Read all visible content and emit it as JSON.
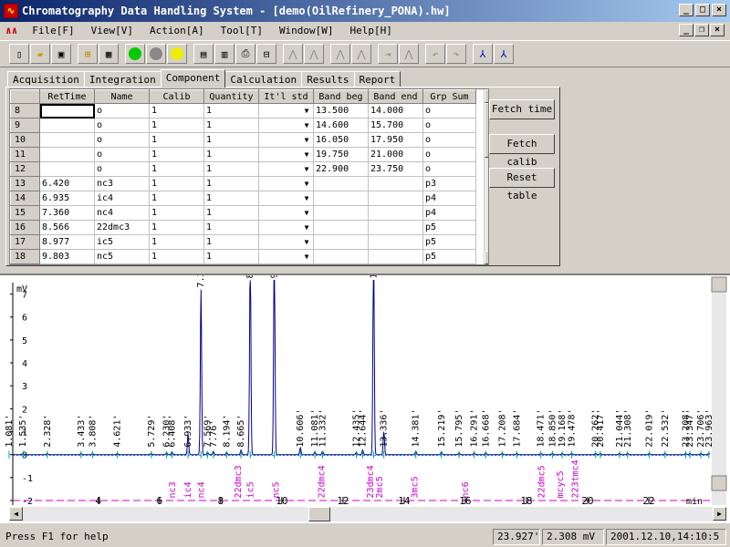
{
  "window": {
    "title": "Chromatography Data Handling System - [demo(OilRefinery_PONA).hw]"
  },
  "menu": [
    "File[F]",
    "View[V]",
    "Action[A]",
    "Tool[T]",
    "Window[W]",
    "Help[H]"
  ],
  "tabs": [
    "Acquisition",
    "Integration",
    "Component",
    "Calculation",
    "Results",
    "Report"
  ],
  "table": {
    "columns": [
      "RetTime",
      "Name",
      "Calib",
      "Quantity",
      "It'l std",
      "Band beg",
      "Band end",
      "Grp Sum"
    ],
    "rows": [
      {
        "n": "8",
        "ret": "",
        "name": "o",
        "calib": "1",
        "qty": "1",
        "std": "",
        "beg": "13.500",
        "end": "14.000",
        "grp": "o"
      },
      {
        "n": "9",
        "ret": "",
        "name": "o",
        "calib": "1",
        "qty": "1",
        "std": "",
        "beg": "14.600",
        "end": "15.700",
        "grp": "o"
      },
      {
        "n": "10",
        "ret": "",
        "name": "o",
        "calib": "1",
        "qty": "1",
        "std": "",
        "beg": "16.050",
        "end": "17.950",
        "grp": "o"
      },
      {
        "n": "11",
        "ret": "",
        "name": "o",
        "calib": "1",
        "qty": "1",
        "std": "",
        "beg": "19.750",
        "end": "21.000",
        "grp": "o"
      },
      {
        "n": "12",
        "ret": "",
        "name": "o",
        "calib": "1",
        "qty": "1",
        "std": "",
        "beg": "22.900",
        "end": "23.750",
        "grp": "o"
      },
      {
        "n": "13",
        "ret": "6.420",
        "name": "nc3",
        "calib": "1",
        "qty": "1",
        "std": "",
        "beg": "",
        "end": "",
        "grp": "p3"
      },
      {
        "n": "14",
        "ret": "6.935",
        "name": "ic4",
        "calib": "1",
        "qty": "1",
        "std": "",
        "beg": "",
        "end": "",
        "grp": "p4"
      },
      {
        "n": "15",
        "ret": "7.360",
        "name": "nc4",
        "calib": "1",
        "qty": "1",
        "std": "",
        "beg": "",
        "end": "",
        "grp": "p4"
      },
      {
        "n": "16",
        "ret": "8.566",
        "name": "22dmc3",
        "calib": "1",
        "qty": "1",
        "std": "",
        "beg": "",
        "end": "",
        "grp": "p5"
      },
      {
        "n": "17",
        "ret": "8.977",
        "name": "ic5",
        "calib": "1",
        "qty": "1",
        "std": "",
        "beg": "",
        "end": "",
        "grp": "p5"
      },
      {
        "n": "18",
        "ret": "9.803",
        "name": "nc5",
        "calib": "1",
        "qty": "1",
        "std": "",
        "beg": "",
        "end": "",
        "grp": "p5"
      }
    ]
  },
  "buttons": {
    "fetch_time": "Fetch time",
    "fetch_calib": "Fetch calib",
    "reset_table": "Reset table"
  },
  "chart_data": {
    "type": "line",
    "ylabel": "mV",
    "xlabel": "min",
    "xlim": [
      1.2,
      24.0
    ],
    "ylim": [
      -2.2,
      7.5
    ],
    "yticks": [
      -2,
      -1,
      0,
      1,
      2,
      3,
      4,
      5,
      6,
      7
    ],
    "xticks": [
      4,
      6,
      8,
      10,
      12,
      14,
      16,
      18,
      20,
      22
    ],
    "peaks": [
      {
        "t": 1.081,
        "h": 0.05
      },
      {
        "t": 1.535,
        "h": 0.05
      },
      {
        "t": 2.328,
        "h": 0.05
      },
      {
        "t": 3.433,
        "h": 0.05
      },
      {
        "t": 3.808,
        "h": 0.05
      },
      {
        "t": 4.621,
        "h": 0.05
      },
      {
        "t": 5.729,
        "h": 0.05
      },
      {
        "t": 6.23,
        "h": 0.08
      },
      {
        "t": 6.408,
        "h": 0.12
      },
      {
        "t": 6.933,
        "h": 0.9
      },
      {
        "t": 7.355,
        "h": 7.2
      },
      {
        "t": 7.569,
        "h": 0.1
      },
      {
        "t": 7.76,
        "h": 0.15
      },
      {
        "t": 8.194,
        "h": 0.1
      },
      {
        "t": 8.665,
        "h": 0.2
      },
      {
        "t": 8.966,
        "h": 9.0
      },
      {
        "t": 9.753,
        "h": 9.0
      },
      {
        "t": 10.606,
        "h": 0.3
      },
      {
        "t": 11.081,
        "h": 0.12
      },
      {
        "t": 11.332,
        "h": 0.15
      },
      {
        "t": 12.435,
        "h": 0.1
      },
      {
        "t": 12.644,
        "h": 0.2
      },
      {
        "t": 13.0,
        "h": 9.0
      },
      {
        "t": 13.336,
        "h": 1.0
      },
      {
        "t": 14.381,
        "h": 0.15
      },
      {
        "t": 15.219,
        "h": 0.12
      },
      {
        "t": 15.795,
        "h": 0.08
      },
      {
        "t": 16.291,
        "h": 0.08
      },
      {
        "t": 16.668,
        "h": 0.08
      },
      {
        "t": 17.208,
        "h": 0.06
      },
      {
        "t": 17.684,
        "h": 0.06
      },
      {
        "t": 18.471,
        "h": 0.06
      },
      {
        "t": 18.85,
        "h": 0.06
      },
      {
        "t": 19.168,
        "h": 0.06
      },
      {
        "t": 19.478,
        "h": 0.06
      },
      {
        "t": 20.262,
        "h": 0.06
      },
      {
        "t": 20.417,
        "h": 0.06
      },
      {
        "t": 21.044,
        "h": 0.06
      },
      {
        "t": 21.308,
        "h": 0.06
      },
      {
        "t": 22.019,
        "h": 0.06
      },
      {
        "t": 22.532,
        "h": 0.06
      },
      {
        "t": 23.208,
        "h": 0.06
      },
      {
        "t": 23.347,
        "h": 0.06
      },
      {
        "t": 23.706,
        "h": 0.06
      },
      {
        "t": 23.963,
        "h": 0.06
      }
    ],
    "peak_labels": [
      {
        "t": 1.081,
        "text": "1.081'"
      },
      {
        "t": 1.535,
        "text": "1.535'"
      },
      {
        "t": 2.328,
        "text": "2.328'"
      },
      {
        "t": 3.433,
        "text": "3.433'"
      },
      {
        "t": 3.808,
        "text": "3.808'"
      },
      {
        "t": 4.621,
        "text": "4.621'"
      },
      {
        "t": 5.729,
        "text": "5.729'"
      },
      {
        "t": 6.23,
        "text": "6.230'"
      },
      {
        "t": 6.408,
        "text": "6.408'"
      },
      {
        "t": 6.933,
        "text": "6.933'"
      },
      {
        "t": 7.355,
        "text": "7.355'"
      },
      {
        "t": 7.569,
        "text": "7.569'"
      },
      {
        "t": 7.76,
        "text": "7.76'"
      },
      {
        "t": 8.194,
        "text": "8.194'"
      },
      {
        "t": 8.665,
        "text": "8.665'"
      },
      {
        "t": 8.966,
        "text": "8.966'"
      },
      {
        "t": 9.753,
        "text": "9.753'"
      },
      {
        "t": 10.606,
        "text": "10.606'"
      },
      {
        "t": 11.081,
        "text": "11.081'"
      },
      {
        "t": 11.332,
        "text": "11.332'"
      },
      {
        "t": 12.435,
        "text": "12.435'"
      },
      {
        "t": 12.644,
        "text": "12.644'"
      },
      {
        "t": 13.0,
        "text": "13.000'"
      },
      {
        "t": 13.336,
        "text": "13.336'"
      },
      {
        "t": 14.381,
        "text": "14.381'"
      },
      {
        "t": 15.219,
        "text": "15.219'"
      },
      {
        "t": 15.795,
        "text": "15.795'"
      },
      {
        "t": 16.291,
        "text": "16.291'"
      },
      {
        "t": 16.668,
        "text": "16.668'"
      },
      {
        "t": 17.208,
        "text": "17.208'"
      },
      {
        "t": 17.684,
        "text": "17.684'"
      },
      {
        "t": 18.471,
        "text": "18.471'"
      },
      {
        "t": 18.85,
        "text": "18.850'"
      },
      {
        "t": 19.168,
        "text": "19.168'"
      },
      {
        "t": 19.478,
        "text": "19.478'"
      },
      {
        "t": 20.262,
        "text": "20.262'"
      },
      {
        "t": 20.417,
        "text": "20.417'"
      },
      {
        "t": 21.044,
        "text": "21.044'"
      },
      {
        "t": 21.308,
        "text": "21.308'"
      },
      {
        "t": 22.019,
        "text": "22.019'"
      },
      {
        "t": 22.532,
        "text": "22.532'"
      },
      {
        "t": 23.208,
        "text": "23.208'"
      },
      {
        "t": 23.347,
        "text": "23.347'"
      },
      {
        "t": 23.706,
        "text": "23.706'"
      },
      {
        "t": 23.963,
        "text": "23.963'"
      }
    ],
    "components": [
      {
        "t": 6.42,
        "text": "nc3"
      },
      {
        "t": 6.935,
        "text": "ic4"
      },
      {
        "t": 7.36,
        "text": "nc4"
      },
      {
        "t": 8.566,
        "text": "22dmc3"
      },
      {
        "t": 8.977,
        "text": "ic5"
      },
      {
        "t": 9.803,
        "text": "nc5"
      },
      {
        "t": 11.3,
        "text": "22dmc4"
      },
      {
        "t": 12.9,
        "text": "23dmc4"
      },
      {
        "t": 13.2,
        "text": "2mc5"
      },
      {
        "t": 14.35,
        "text": "3mc5"
      },
      {
        "t": 16.0,
        "text": "nc6"
      },
      {
        "t": 18.5,
        "text": "22dmc5"
      },
      {
        "t": 19.1,
        "text": "mcyc5"
      },
      {
        "t": 19.6,
        "text": "223tmc4"
      }
    ],
    "component_color": "#cc00cc",
    "line_color": "#00008b",
    "tick_color": "#00a0a0"
  },
  "status": {
    "help": "Press F1 for help",
    "time": "23.927'",
    "signal": "2.308 mV",
    "datetime": "2001.12.10,14:10:5"
  }
}
